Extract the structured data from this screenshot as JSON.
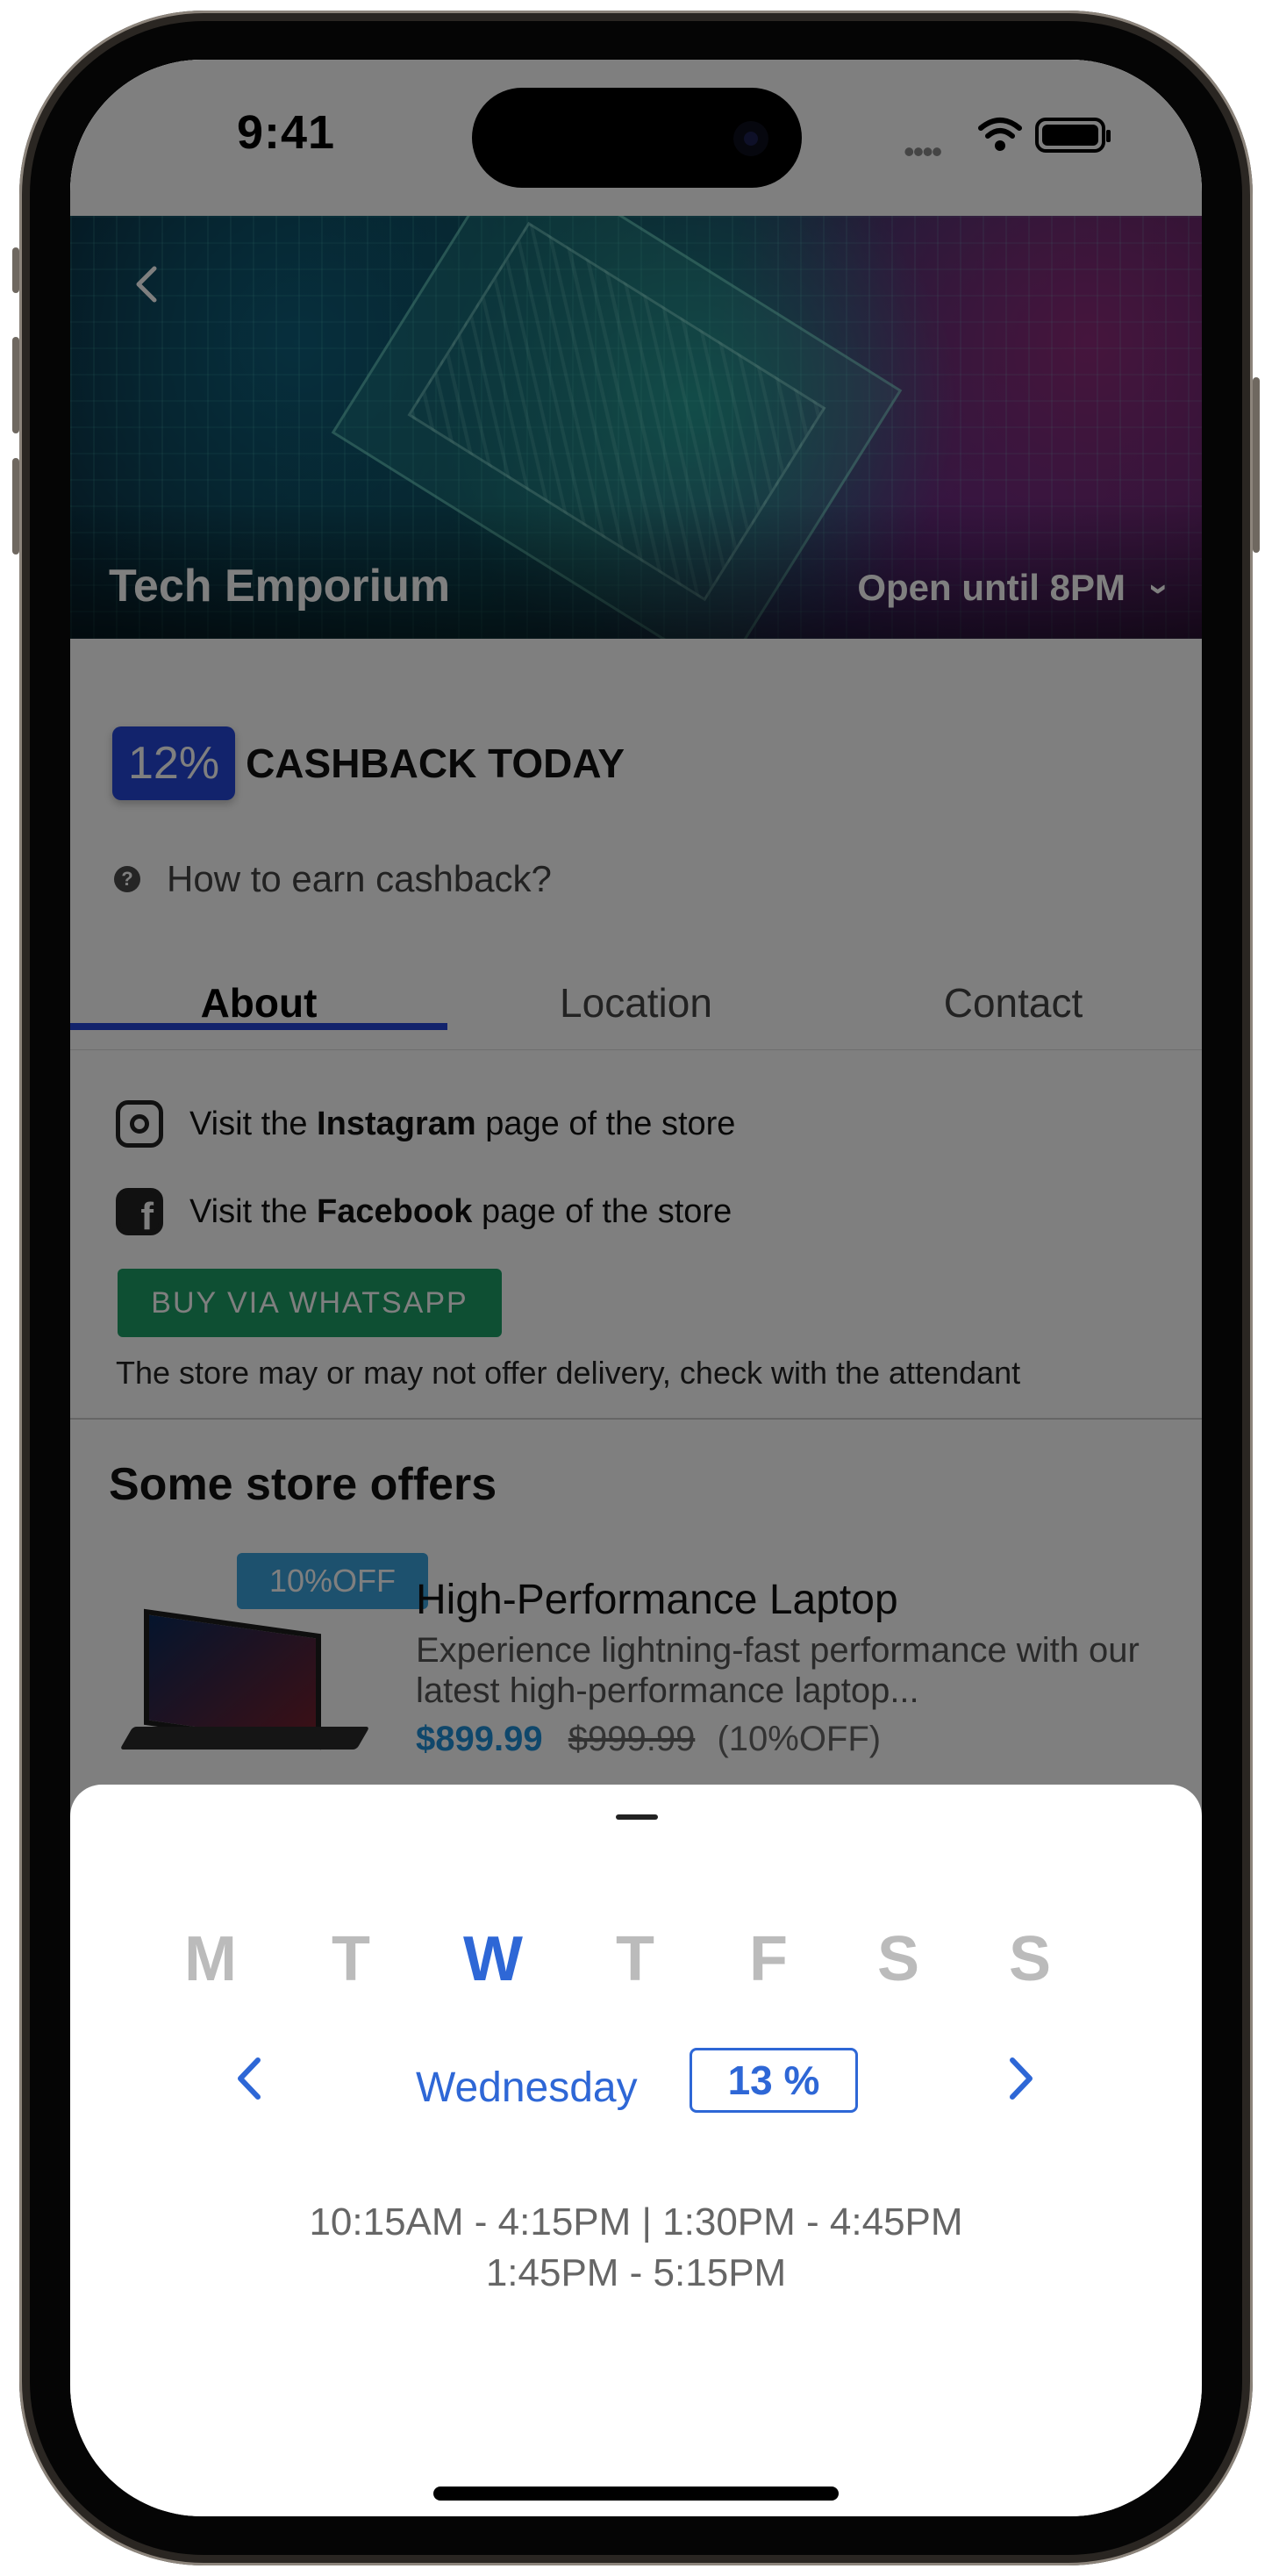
{
  "status_bar": {
    "time": "9:41",
    "signal": "••••"
  },
  "header": {
    "store_name": "Tech Emporium",
    "hours": "Open until 8PM",
    "back_icon": "chevron-left-icon"
  },
  "cashback": {
    "badge": "12%",
    "label": "CASHBACK TODAY",
    "help": "How to earn cashback?"
  },
  "tabs": [
    {
      "label": "About"
    },
    {
      "label": "Location"
    },
    {
      "label": "Contact"
    }
  ],
  "about": {
    "instagram": {
      "pre": "Visit the ",
      "bold": "Instagram",
      "post": " page of the store"
    },
    "facebook": {
      "pre": "Visit the ",
      "bold": "Facebook",
      "post": " page of the store"
    },
    "whatsapp_button": "BUY VIA WHATSAPP",
    "disclaimer": "The store may or may not offer delivery, check with the attendant"
  },
  "offers": {
    "title": "Some store offers",
    "items": [
      {
        "badge": "10%OFF",
        "name": "High-Performance Laptop",
        "description": "Experience lightning-fast performance with our latest high-performance laptop...",
        "price": "$899.99",
        "old_price": "$999.99",
        "discount": "(10%OFF)"
      }
    ]
  },
  "schedule_sheet": {
    "days": [
      "M",
      "T",
      "W",
      "T",
      "F",
      "S",
      "S"
    ],
    "selected_day_index": 2,
    "selected_day_name": "Wednesday",
    "cashback_percent": "13 %",
    "hours_line1": "10:15AM - 4:15PM | 1:30PM - 4:45PM",
    "hours_line2": "1:45PM - 5:15PM"
  },
  "colors": {
    "accent": "#2446d8",
    "sheet_accent": "#2e67d6",
    "whatsapp": "#1d9e67",
    "price": "#1e8fd6"
  }
}
